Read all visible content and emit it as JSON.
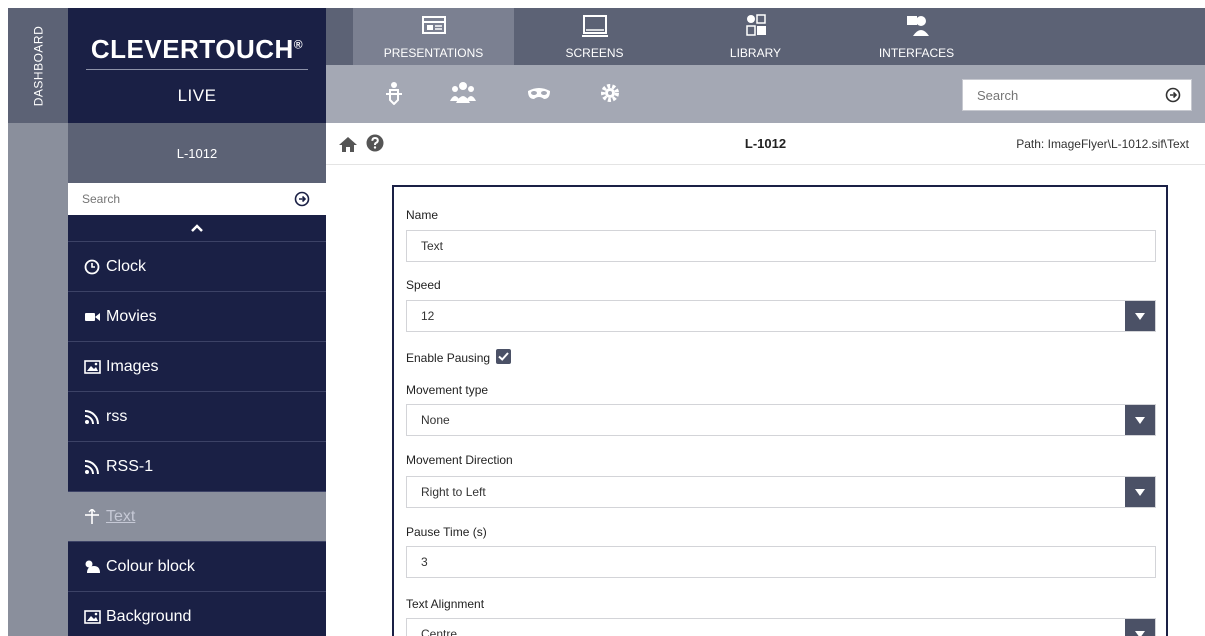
{
  "dashboard_label": "DASHBOARD",
  "brand": {
    "name": "CLEVERTOUCH",
    "mark": "®",
    "sub": "LIVE"
  },
  "nav_tabs": [
    {
      "label": "PRESENTATIONS",
      "icon": "presentation-icon",
      "active": true
    },
    {
      "label": "SCREENS",
      "icon": "monitor-icon",
      "active": false
    },
    {
      "label": "LIBRARY",
      "icon": "library-icon",
      "active": false
    },
    {
      "label": "INTERFACES",
      "icon": "interface-icon",
      "active": false
    }
  ],
  "subbar_icons": [
    "drag-move-icon",
    "users-icon",
    "mask-icon",
    "gear-icon"
  ],
  "top_search": {
    "placeholder": "Search"
  },
  "sidebar": {
    "title": "L-1012",
    "search_placeholder": "Search",
    "items": [
      {
        "label": "Clock",
        "icon": "clock-icon"
      },
      {
        "label": "Movies",
        "icon": "video-camera-icon"
      },
      {
        "label": "Images",
        "icon": "image-icon"
      },
      {
        "label": "rss",
        "icon": "rss-icon"
      },
      {
        "label": "RSS-1",
        "icon": "rss-icon"
      },
      {
        "label": "Text",
        "icon": "move-cursor-icon",
        "active": true
      },
      {
        "label": "Colour block",
        "icon": "colour-block-icon"
      },
      {
        "label": "Background",
        "icon": "image-icon"
      }
    ]
  },
  "content": {
    "title": "L-1012",
    "path": "Path: ImageFlyer\\L-1012.sif\\Text"
  },
  "form": {
    "name_label": "Name",
    "name_value": "Text",
    "speed_label": "Speed",
    "speed_value": "12",
    "enable_pausing_label": "Enable Pausing",
    "enable_pausing_checked": true,
    "movement_type_label": "Movement type",
    "movement_type_value": "None",
    "movement_direction_label": "Movement Direction",
    "movement_direction_value": "Right to Left",
    "pause_time_label": "Pause Time (s)",
    "pause_time_value": "3",
    "text_alignment_label": "Text Alignment",
    "text_alignment_value": "Centre"
  },
  "colors": {
    "navy": "#1a2045",
    "slate": "#5c6275",
    "grey": "#8a8f9c",
    "subbar": "#a4a8b4"
  }
}
